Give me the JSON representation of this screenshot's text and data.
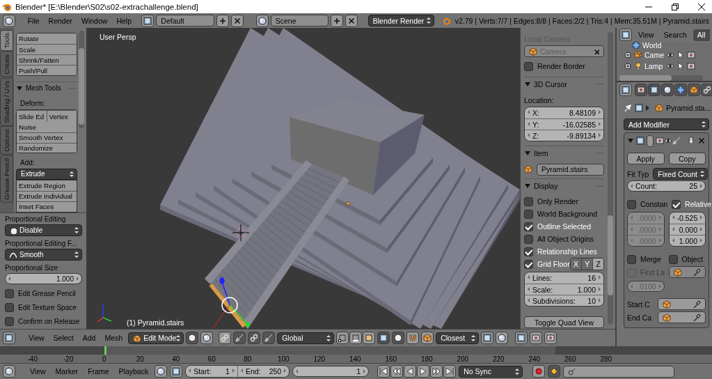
{
  "window": {
    "title": "Blender* [E:\\Blender\\S02\\s02-extrachallenge.blend]"
  },
  "info_header": {
    "menus": [
      "File",
      "Render",
      "Window",
      "Help"
    ],
    "screen_layout": "Default",
    "scene": "Scene",
    "render_engine": "Blender Render",
    "stats": "v2.79 | Verts:7/7 | Edges:8/8 | Faces:2/2 | Tris:4 | Mem:35.51M | Pyramid.stairs"
  },
  "tool_tabs": [
    {
      "label": "Tools",
      "selected": true
    },
    {
      "label": "Create",
      "selected": false
    },
    {
      "label": "Shading / UVs",
      "selected": false
    },
    {
      "label": "Options",
      "selected": false
    },
    {
      "label": "Grease Pencil",
      "selected": false
    }
  ],
  "toolshelf": {
    "transform_buttons": [
      "Rotate",
      "Scale",
      "Shrink/Fatten",
      "Push/Pull"
    ],
    "mesh_tools": {
      "title": "Mesh Tools",
      "deform_label": "Deform:",
      "deform_row": [
        "Slide Ed",
        "Vertex"
      ],
      "deform_buttons": [
        "Noise",
        "Smooth Vertex",
        "Randomize"
      ],
      "add_label": "Add:",
      "extrude_dropdown": "Extrude",
      "add_buttons": [
        "Extrude Region",
        "Extrude Individual",
        "Inset Faces"
      ]
    }
  },
  "last_operator": {
    "proportional_label": "Proportional Editing",
    "proportional": "Disable",
    "falloff_label": "Proportional Editing F...",
    "falloff": "Smooth",
    "size_label": "Proportional Size",
    "size": "1.000",
    "options": [
      {
        "label": "Edit Grease Pencil",
        "checked": false
      },
      {
        "label": "Edit Texture Space",
        "checked": false
      },
      {
        "label": "Confirm on Release",
        "checked": false
      }
    ]
  },
  "viewport": {
    "view_name": "User Persp",
    "object_info": "(1) Pyramid.stairs"
  },
  "n_panel": {
    "local_camera_label": "Local Camera:",
    "local_camera": "Camera",
    "render_border": {
      "label": "Render Border",
      "checked": false
    },
    "cursor_panel": {
      "title": "3D Cursor",
      "location_label": "Location:",
      "fields": [
        {
          "label": "X:",
          "value": "8.48109"
        },
        {
          "label": "Y:",
          "value": "-16.02585"
        },
        {
          "label": "Z:",
          "value": "-9.89134"
        }
      ]
    },
    "item_panel": {
      "title": "Item",
      "name": "Pyramid.stairs"
    },
    "display_panel": {
      "title": "Display",
      "options": [
        {
          "label": "Only Render",
          "checked": false
        },
        {
          "label": "World Background",
          "checked": false
        },
        {
          "label": "Outline Selected",
          "checked": true
        },
        {
          "label": "All Object Origins",
          "checked": false
        },
        {
          "label": "Relationship Lines",
          "checked": true
        },
        {
          "label": "Grid Floor",
          "checked": true
        }
      ],
      "grid_axes": [
        {
          "label": "X",
          "selected": false
        },
        {
          "label": "Y",
          "selected": false
        },
        {
          "label": "Z",
          "selected": true
        }
      ],
      "fields": [
        {
          "label": "Lines:",
          "value": "16"
        },
        {
          "label": "Scale:",
          "value": "1.000"
        },
        {
          "label": "Subdivisions:",
          "value": "10"
        }
      ],
      "toggle_quad_view": "Toggle Quad View"
    }
  },
  "outliner": {
    "menus": [
      "View",
      "Search"
    ],
    "filter": "All",
    "items": [
      "World",
      "Came",
      "Lamp"
    ]
  },
  "properties": {
    "object_name": "Pyramid.sta...",
    "add_modifier": "Add Modifier",
    "modifier": {
      "apply": "Apply",
      "copy": "Copy",
      "fit_type_label": "Fit Typ",
      "fit_type": "Fixed Count",
      "count": {
        "label": "Count:",
        "value": "25"
      },
      "constant_offset": {
        "label": "Constan",
        "checked": false,
        "values": [
          ".0000",
          ".0000",
          ".0000"
        ]
      },
      "relative_offset": {
        "label": "Relative",
        "checked": true,
        "values": [
          "-0.525",
          "0.000",
          "1.000"
        ]
      },
      "merge": {
        "label": "Merge",
        "checked": false
      },
      "object_offset": {
        "label": "Object",
        "checked": false
      },
      "first_last": {
        "label": "First La",
        "checked": false
      },
      "merge_distance": ".0100",
      "start_cap_label": "Start C",
      "end_cap_label": "End Ca"
    }
  },
  "view3d_header": {
    "menus": [
      "View",
      "Select",
      "Add",
      "Mesh"
    ],
    "mode": "Edit Mode",
    "orientation": "Global",
    "snap_target": "Closest"
  },
  "timeline": {
    "ruler_labels": [
      "-40",
      "-20",
      "0",
      "20",
      "40",
      "60",
      "80",
      "100",
      "120",
      "140",
      "160",
      "180",
      "200",
      "220",
      "240",
      "260",
      "280"
    ],
    "menus": [
      "View",
      "Marker",
      "Frame",
      "Playback"
    ],
    "start": {
      "label": "Start:",
      "value": "1"
    },
    "end": {
      "label": "End:",
      "value": "250"
    },
    "current_frame": "1",
    "sync_mode": "No Sync"
  }
}
